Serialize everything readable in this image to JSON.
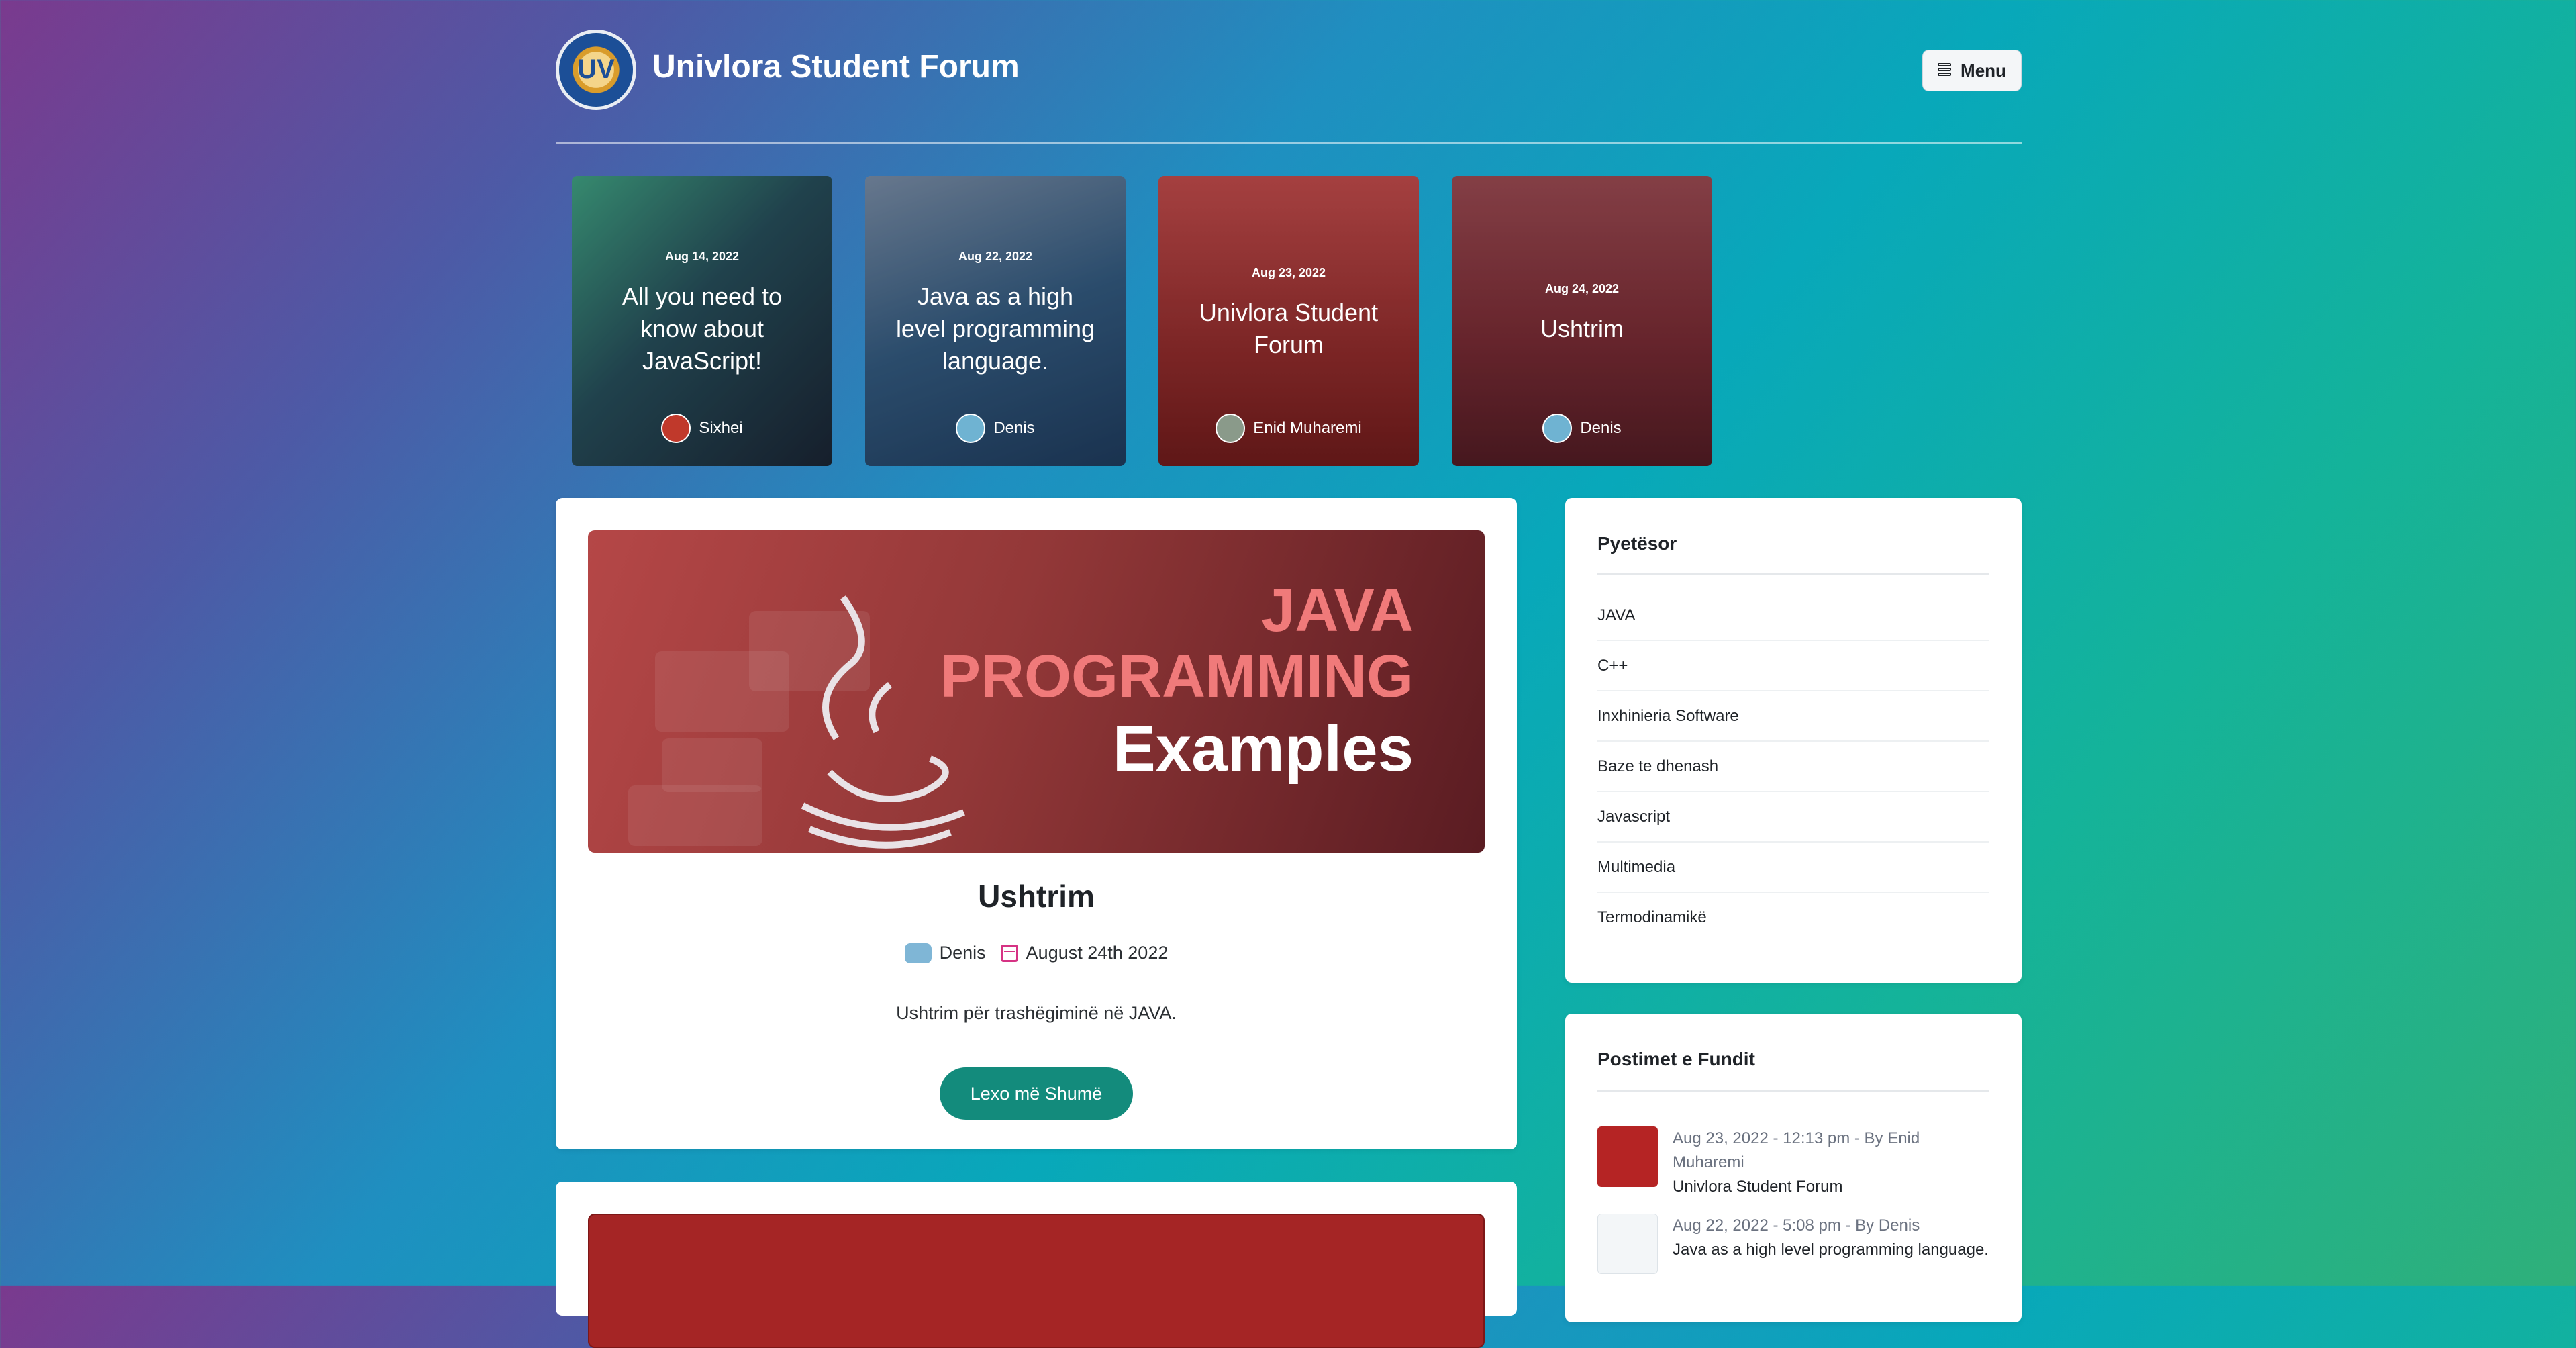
{
  "header": {
    "logo_text": "UV",
    "site_title": "Univlora Student Forum",
    "menu_label": "Menu"
  },
  "featured": [
    {
      "date": "Aug 14, 2022",
      "title": "All you need to know about JavaScript!",
      "author": "Sixhei"
    },
    {
      "date": "Aug 22, 2022",
      "title": "Java as a high level programming language.",
      "author": "Denis"
    },
    {
      "date": "Aug 23, 2022",
      "title": "Univlora Student Forum",
      "author": "Enid Muharemi"
    },
    {
      "date": "Aug 24, 2022",
      "title": "Ushtrim",
      "author": "Denis"
    }
  ],
  "post": {
    "image_text": {
      "line1": "JAVA",
      "line2": "PROGRAMMING",
      "line3": "Examples"
    },
    "title": "Ushtrim",
    "author": "Denis",
    "date": "August 24th 2022",
    "excerpt": "Ushtrim për trashëgiminë në JAVA.",
    "read_more": "Lexo më Shumë"
  },
  "sidebar": {
    "categories_title": "Pyetësor",
    "categories": [
      "JAVA",
      "C++",
      "Inxhinieria Software",
      "Baze te dhenash",
      "Javascript",
      "Multimedia",
      "Termodinamikë"
    ],
    "recent_title": "Postimet e Fundit",
    "recent": [
      {
        "meta": "Aug 23, 2022 - 12:13 pm - By Enid Muharemi",
        "title": "Univlora Student Forum"
      },
      {
        "meta": "Aug 22, 2022 - 5:08 pm - By Denis",
        "title": "Java as a high level programming language."
      }
    ]
  },
  "colors": {
    "accent": "#138b7c",
    "date_icon": "#d63384"
  }
}
